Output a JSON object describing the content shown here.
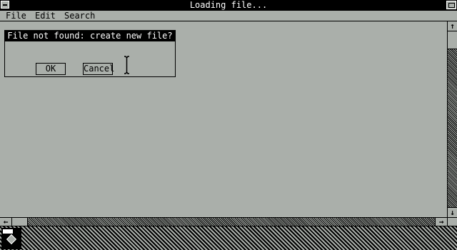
{
  "window": {
    "title": "Loading file..."
  },
  "menubar": {
    "items": [
      "File",
      "Edit",
      "Search"
    ]
  },
  "dialog": {
    "title": "File not found: create new file?",
    "ok_label": "OK",
    "cancel_label": "Cancel"
  },
  "scrollbars": {
    "up_arrow": "↑",
    "down_arrow": "↓",
    "left_arrow": "←",
    "right_arrow": "→"
  },
  "icons": [
    "system-menu-icon",
    "maximize-icon",
    "text-cursor-icon",
    "desktop-app-icon"
  ]
}
